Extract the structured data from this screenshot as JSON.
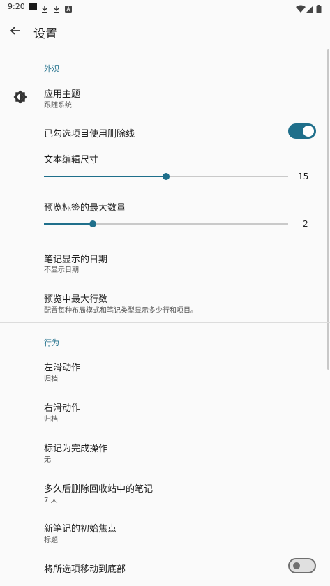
{
  "status_bar": {
    "time": "9:20",
    "icons": [
      "notification-square-icon",
      "download-icon",
      "download-icon",
      "app-a-icon",
      "wifi-icon",
      "signal-icon",
      "battery-icon"
    ]
  },
  "toolbar": {
    "title": "设置"
  },
  "sections": {
    "appearance": {
      "header": "外观",
      "theme": {
        "title": "应用主题",
        "summary": "跟随系统"
      },
      "strikethrough": {
        "title": "已勾选项目使用删除线",
        "enabled": true
      },
      "text_size": {
        "title": "文本编辑尺寸",
        "value": "15",
        "fraction": 0.5
      },
      "max_labels": {
        "title": "预览标签的最大数量",
        "value": "2",
        "fraction": 0.2
      },
      "date_display": {
        "title": "笔记显示的日期",
        "summary": "不显示日期"
      },
      "max_lines": {
        "title": "预览中最大行数",
        "summary": "配置每种布局模式和笔记类型显示多少行和项目。"
      }
    },
    "behavior": {
      "header": "行为",
      "swipe_left": {
        "title": "左滑动作",
        "summary": "归档"
      },
      "swipe_right": {
        "title": "右滑动作",
        "summary": "归档"
      },
      "mark_done": {
        "title": "标记为完成操作",
        "summary": "无"
      },
      "delete_after": {
        "title": "多久后删除回收站中的笔记",
        "summary": "7 天"
      },
      "initial_focus": {
        "title": "新笔记的初始焦点",
        "summary": "标题"
      },
      "move_checked": {
        "title": "将所选项移动到底部",
        "enabled": false
      }
    }
  },
  "colors": {
    "accent": "#1f6f8b",
    "background": "#fafafa",
    "divider": "#dcdcdc"
  }
}
